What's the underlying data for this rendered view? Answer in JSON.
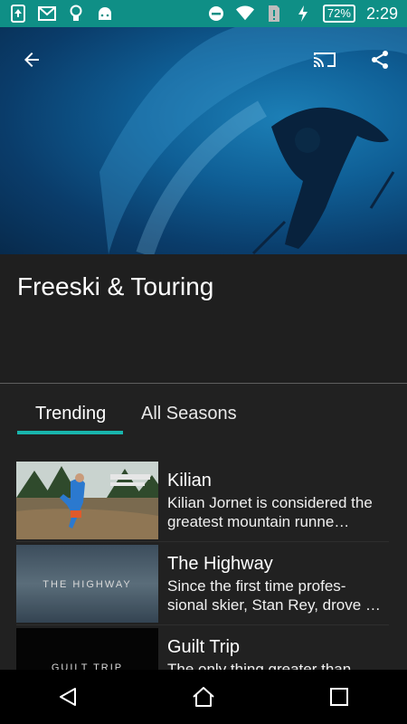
{
  "status_bar": {
    "battery": "72%",
    "time": "2:29"
  },
  "show": {
    "title": "Freeski & Touring"
  },
  "tabs": [
    {
      "label": "Trending"
    },
    {
      "label": "All Seasons"
    }
  ],
  "episodes": [
    {
      "title": "Kilian",
      "description": "Kilian Jornet is considered the greatest mountain runne…"
    },
    {
      "title": "The Highway",
      "description": "Since the first time profes-sional skier, Stan Rey, drove …",
      "thumb_text": "THE HIGHWAY"
    },
    {
      "title": "Guilt Trip",
      "description": "The only thing greater than",
      "thumb_text": "GUILT TRIP"
    }
  ],
  "colors": {
    "status_bar": "#0f8f86",
    "accent": "#19b5ad",
    "background": "#212121"
  }
}
